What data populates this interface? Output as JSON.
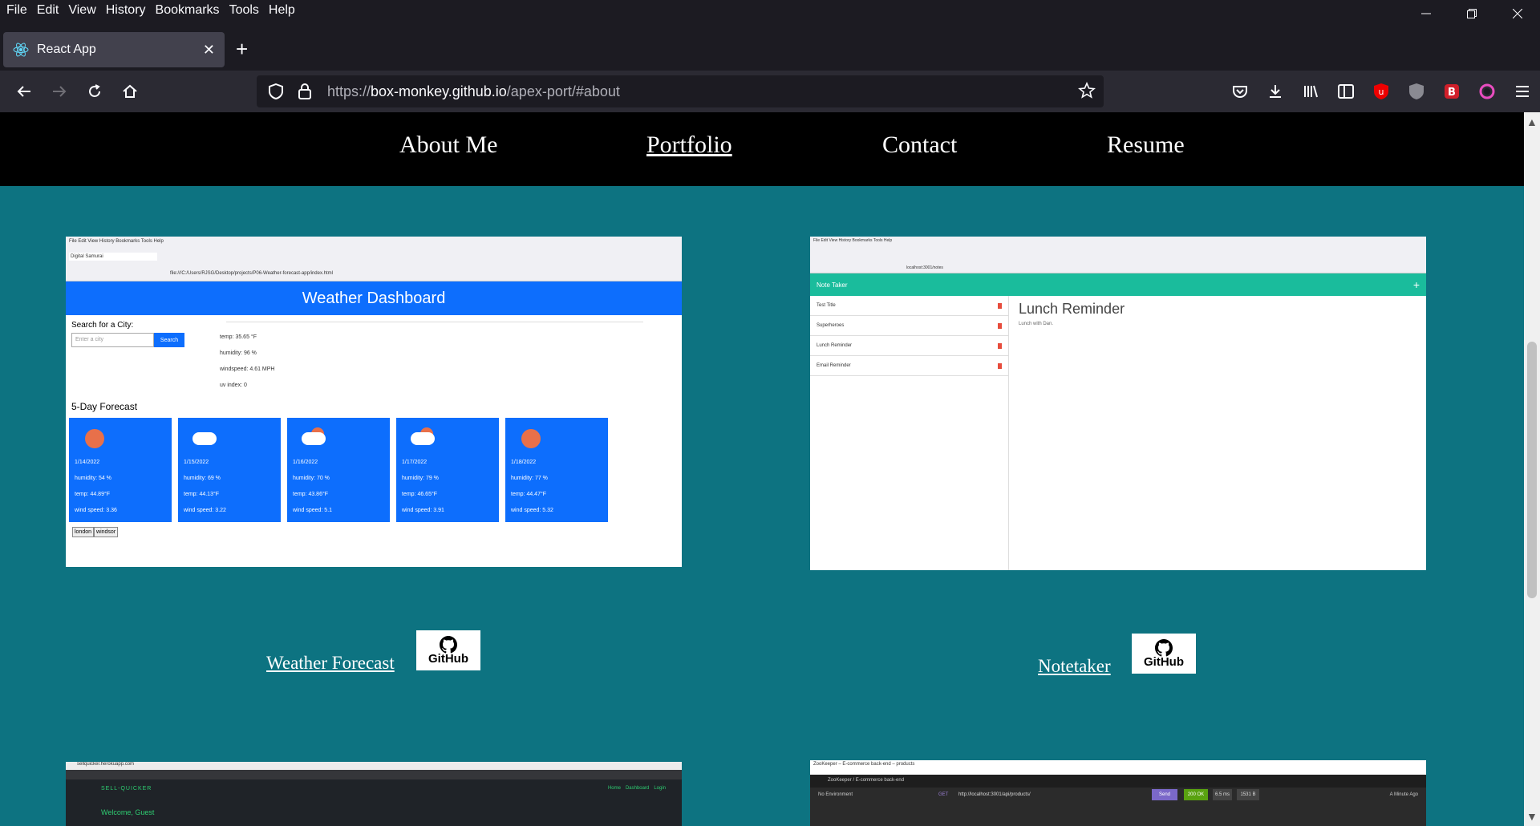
{
  "menu": [
    "File",
    "Edit",
    "View",
    "History",
    "Bookmarks",
    "Tools",
    "Help"
  ],
  "tab": {
    "title": "React App"
  },
  "url": {
    "scheme": "https://",
    "host": "box-monkey.github.io",
    "path": "/apex-port/#about"
  },
  "site_nav": {
    "about": "About Me",
    "portfolio": "Portfolio",
    "contact": "Contact",
    "resume": "Resume"
  },
  "projects": [
    {
      "title": "Weather Forecast",
      "badge": "GitHub"
    },
    {
      "title": "Notetaker",
      "badge": "GitHub"
    }
  ],
  "weather_shot": {
    "header": "Weather Dashboard",
    "tab_title": "Digital Samurai",
    "address": "file:///C:/Users/RJSG/Desktop/projects/P06-Weather-forecast-app/index.html",
    "search_label": "Search for a City:",
    "search_placeholder": "Enter a city",
    "search_button": "Search",
    "current": [
      "temp: 35.65 °F",
      "humidity: 96 %",
      "windspeed: 4.61 MPH",
      "uv index: 0"
    ],
    "forecast_title": "5-Day Forecast",
    "days": [
      {
        "date": "1/14/2022",
        "humidity": "humidity: 54 %",
        "temp": "temp: 44.89°F",
        "wind": "wind speed: 3.36",
        "icon": "sun"
      },
      {
        "date": "1/15/2022",
        "humidity": "humidity: 69 %",
        "temp": "temp: 44.13°F",
        "wind": "wind speed: 3.22",
        "icon": "cloud"
      },
      {
        "date": "1/16/2022",
        "humidity": "humidity: 70 %",
        "temp": "temp: 43.86°F",
        "wind": "wind speed: 5.1",
        "icon": "partly"
      },
      {
        "date": "1/17/2022",
        "humidity": "humidity: 79 %",
        "temp": "temp: 46.65°F",
        "wind": "wind speed: 3.91",
        "icon": "partly"
      },
      {
        "date": "1/18/2022",
        "humidity": "humidity: 77 %",
        "temp": "temp: 44.47°F",
        "wind": "wind speed: 5.32",
        "icon": "sun"
      }
    ],
    "history": [
      "london",
      "windsor"
    ]
  },
  "note_shot": {
    "app_title": "Note Taker",
    "address": "localhost:3001/notes",
    "notes": [
      "Test Title",
      "Superheroes",
      "Lunch Reminder",
      "Email Reminder"
    ],
    "active_title": "Lunch Reminder",
    "active_body": "Lunch with Dan."
  },
  "sellquicker_shot": {
    "address": "sellquicker.herokuapp.com",
    "brand": "SELL-QUICKER",
    "nav": [
      "Home",
      "Dashboard",
      "Login"
    ],
    "welcome": "Welcome, Guest"
  },
  "zookeeper_shot": {
    "title": "ZooKeeper – E-commerce back-end – products",
    "breadcrumb": "ZooKeeper / E-commerce back-end",
    "env": "No Environment",
    "method": "GET",
    "request_url": "http://localhost:3001/api/products/",
    "send": "Send",
    "status": "200 OK",
    "time": "6.5 ms",
    "size": "1531 B",
    "ago": "A Minute Ago"
  },
  "colors": {
    "page_bg": "#0d7381",
    "nav_bg": "#000000",
    "browser_bg": "#1c1b22"
  }
}
